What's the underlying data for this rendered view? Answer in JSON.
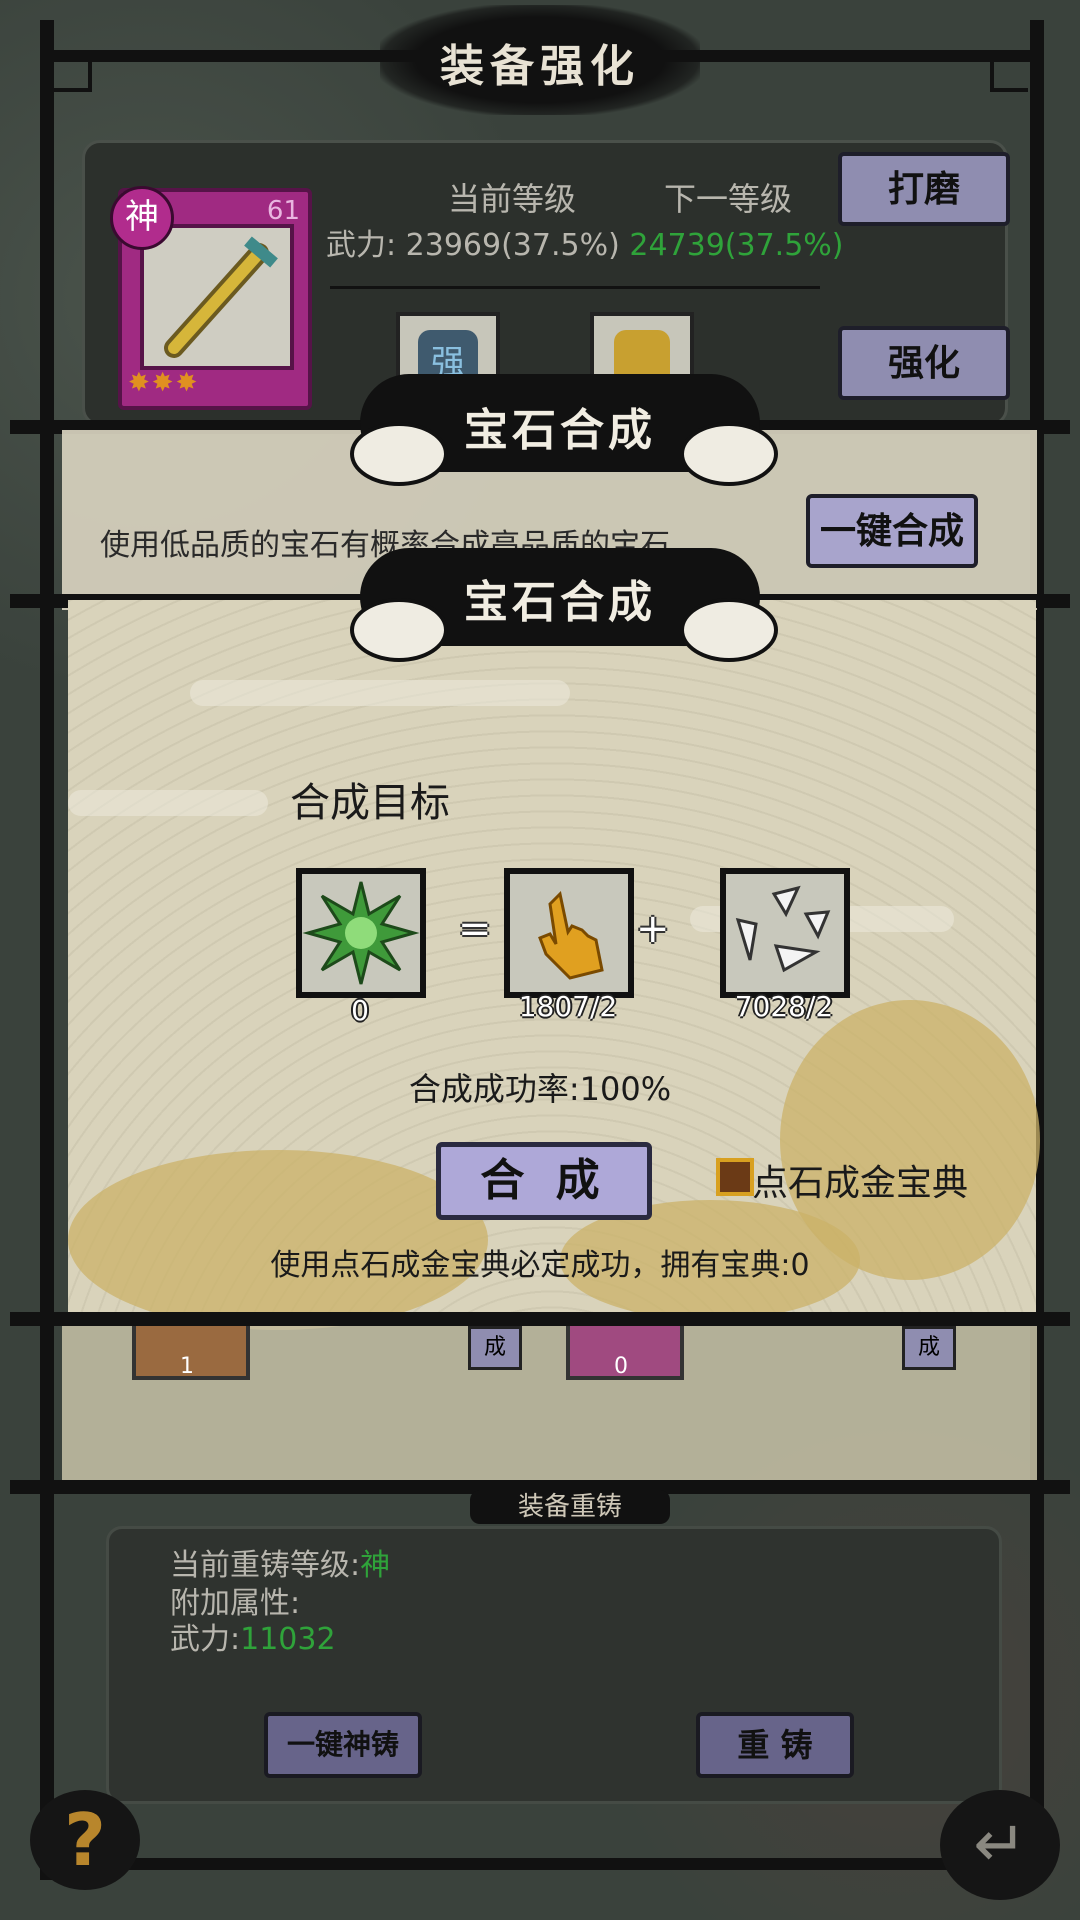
{
  "window": {
    "title": "装备强化"
  },
  "equipment": {
    "quality_badge": "神",
    "level": "61",
    "stars": "✸✸✸",
    "current_level_label": "当前等级",
    "next_level_label": "下一等级",
    "power_label": "武力:",
    "power_current": "23969(37.5%)",
    "power_next": "24739(37.5%)",
    "gem_slot_1_text": "强"
  },
  "buttons": {
    "polish": "打磨",
    "enhance": "强化",
    "one_key_compose": "一键合成",
    "compose": "合 成",
    "one_key_divine": "一键神铸",
    "recast": "重 铸"
  },
  "banners": {
    "gem_compose_back": "宝石合成",
    "gem_compose_front": "宝石合成",
    "recast_header": "装备重铸"
  },
  "mid_panel": {
    "desc": "使用低品质的宝石有概率合成高品质的宝石"
  },
  "compose": {
    "target_label": "合成目标",
    "target_count": "0",
    "equals": "=",
    "plus": "+",
    "material_1_count": "1807/2",
    "material_2_count": "7028/2",
    "success_rate": "合成成功率:100%",
    "checkbox_label": "点石成金宝典",
    "hint": "使用点石成金宝典必定成功，拥有宝典:0"
  },
  "behind_items": {
    "gem_a_count": "1",
    "gem_b_count": "0",
    "compose_small": "成"
  },
  "recast": {
    "current_level_label": "当前重铸等级:",
    "current_level_value": "神",
    "extra_attr_label": "附加属性:",
    "power_label": "武力:",
    "power_value": "11032"
  },
  "icons": [
    "help-icon",
    "back-icon"
  ],
  "colors": {
    "accent_green": "#2fa33a",
    "button_purple": "#aea8d8",
    "epic_magenta": "#a02a82"
  }
}
